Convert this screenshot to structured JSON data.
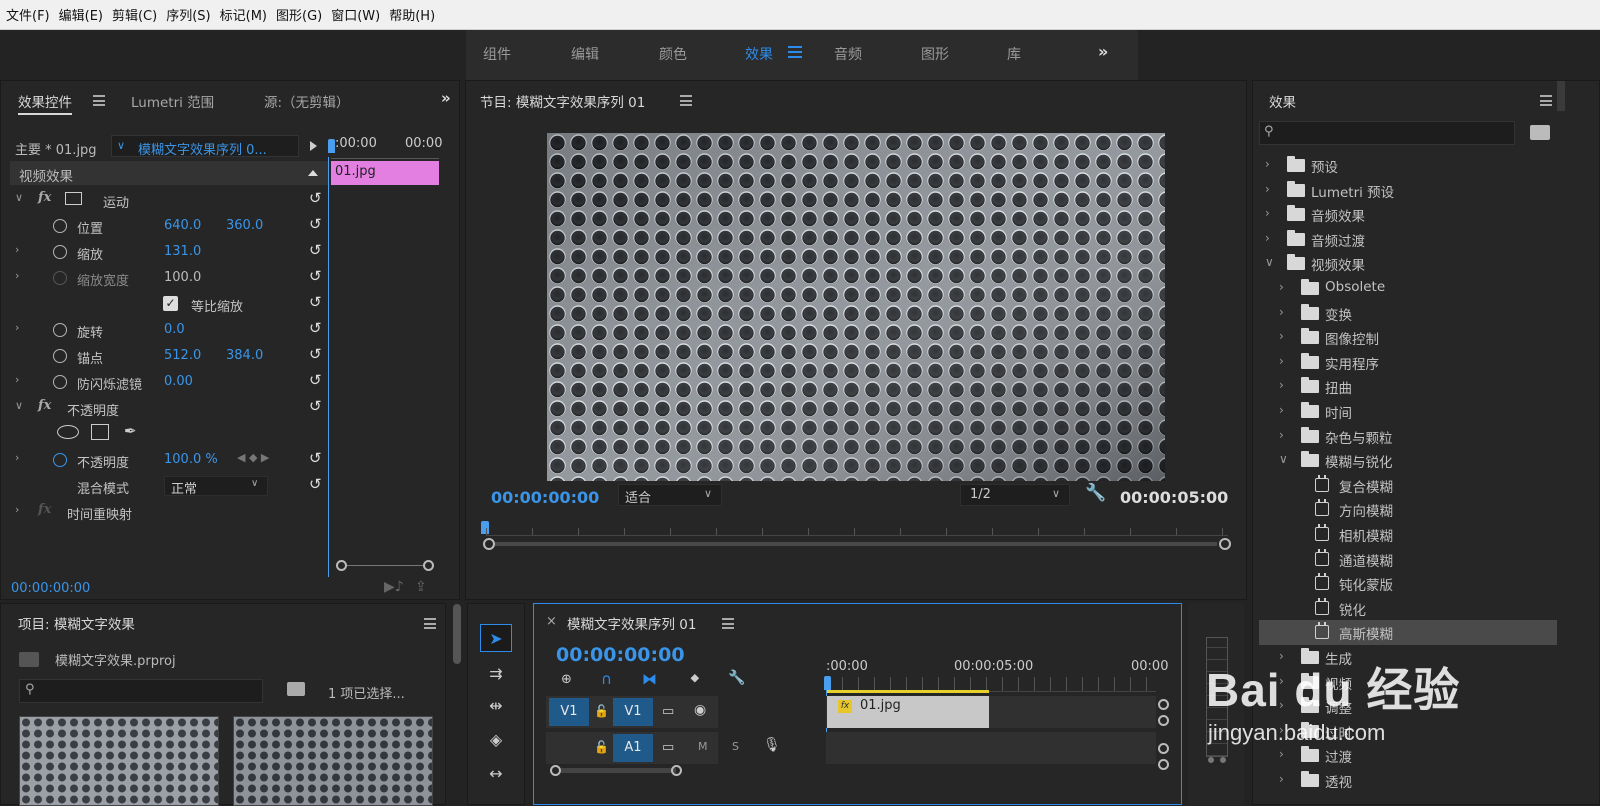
{
  "menu": [
    "文件(F)",
    "编辑(E)",
    "剪辑(C)",
    "序列(S)",
    "标记(M)",
    "图形(G)",
    "窗口(W)",
    "帮助(H)"
  ],
  "workspaces": [
    "组件",
    "编辑",
    "颜色",
    "效果",
    "音频",
    "图形",
    "库"
  ],
  "workspace_active": "效果",
  "effect_controls": {
    "tabs": [
      "效果控件",
      "Lumetri 范围",
      "源:（无剪辑）"
    ],
    "master_label": "主要 * 01.jpg",
    "sequence_label": "模糊文字效果序列 0...",
    "time_start": ":00:00",
    "time_end": "00:00",
    "clip_label": "01.jpg",
    "section": "视频效果",
    "motion": "运动",
    "position_label": "位置",
    "position_x": "640.0",
    "position_y": "360.0",
    "scale_label": "缩放",
    "scale_value": "131.0",
    "scale_width_label": "缩放宽度",
    "scale_width_value": "100.0",
    "uniform_scale": "等比缩放",
    "rotation_label": "旋转",
    "rotation_value": "0.0",
    "anchor_label": "锚点",
    "anchor_x": "512.0",
    "anchor_y": "384.0",
    "flicker_label": "防闪烁滤镜",
    "flicker_value": "0.00",
    "opacity_section": "不透明度",
    "opacity_label": "不透明度",
    "opacity_value": "100.0 %",
    "blend_label": "混合模式",
    "blend_value": "正常",
    "time_remap": "时间重映射",
    "timecode": "00:00:00:00"
  },
  "program": {
    "title": "节目: 模糊文字效果序列 01",
    "timecode": "00:00:00:00",
    "fit": "适合",
    "resolution": "1/2",
    "duration": "00:00:05:00"
  },
  "project": {
    "title": "项目: 模糊文字效果",
    "file": "模糊文字效果.prproj",
    "selected": "1 项已选择..."
  },
  "timeline": {
    "title": "模糊文字效果序列 01",
    "close": "×",
    "timecode": "00:00:00:00",
    "ruler": [
      ":00:00",
      "00:00:05:00",
      "00:00"
    ],
    "v1_src": "V1",
    "v1": "V1",
    "a1": "A1",
    "m": "M",
    "s": "S",
    "clip": "01.jpg",
    "fx_badge": "fx"
  },
  "effects": {
    "title": "效果",
    "items": [
      {
        "label": "预设",
        "level": 0,
        "open": false,
        "kind": "star"
      },
      {
        "label": "Lumetri 预设",
        "level": 0,
        "open": false,
        "kind": "star"
      },
      {
        "label": "音频效果",
        "level": 0,
        "open": false,
        "kind": "folder"
      },
      {
        "label": "音频过渡",
        "level": 0,
        "open": false,
        "kind": "folder"
      },
      {
        "label": "视频效果",
        "level": 0,
        "open": true,
        "kind": "folder"
      },
      {
        "label": "Obsolete",
        "level": 1,
        "open": false,
        "kind": "folder"
      },
      {
        "label": "变换",
        "level": 1,
        "open": false,
        "kind": "folder"
      },
      {
        "label": "图像控制",
        "level": 1,
        "open": false,
        "kind": "folder"
      },
      {
        "label": "实用程序",
        "level": 1,
        "open": false,
        "kind": "folder"
      },
      {
        "label": "扭曲",
        "level": 1,
        "open": false,
        "kind": "folder"
      },
      {
        "label": "时间",
        "level": 1,
        "open": false,
        "kind": "folder"
      },
      {
        "label": "杂色与颗粒",
        "level": 1,
        "open": false,
        "kind": "folder"
      },
      {
        "label": "模糊与锐化",
        "level": 1,
        "open": true,
        "kind": "folder"
      },
      {
        "label": "复合模糊",
        "level": 2,
        "kind": "effect"
      },
      {
        "label": "方向模糊",
        "level": 2,
        "kind": "effect"
      },
      {
        "label": "相机模糊",
        "level": 2,
        "kind": "effect"
      },
      {
        "label": "通道模糊",
        "level": 2,
        "kind": "effect"
      },
      {
        "label": "钝化蒙版",
        "level": 2,
        "kind": "effect"
      },
      {
        "label": "锐化",
        "level": 2,
        "kind": "effect"
      },
      {
        "label": "高斯模糊",
        "level": 2,
        "kind": "effect",
        "selected": true
      },
      {
        "label": "生成",
        "level": 1,
        "open": false,
        "kind": "folder"
      },
      {
        "label": "视频",
        "level": 1,
        "open": false,
        "kind": "folder"
      },
      {
        "label": "调整",
        "level": 1,
        "open": false,
        "kind": "folder"
      },
      {
        "label": "过时",
        "level": 1,
        "open": false,
        "kind": "folder"
      },
      {
        "label": "过渡",
        "level": 1,
        "open": false,
        "kind": "folder"
      },
      {
        "label": "透视",
        "level": 1,
        "open": false,
        "kind": "folder"
      }
    ]
  },
  "watermark": {
    "brand": "Bai du 经验",
    "url": "jingyan.baidu.com"
  },
  "colors": {
    "accent": "#2d8ceb",
    "clip_pink": "#e27fe0",
    "track_blue": "#1f5a8a"
  }
}
